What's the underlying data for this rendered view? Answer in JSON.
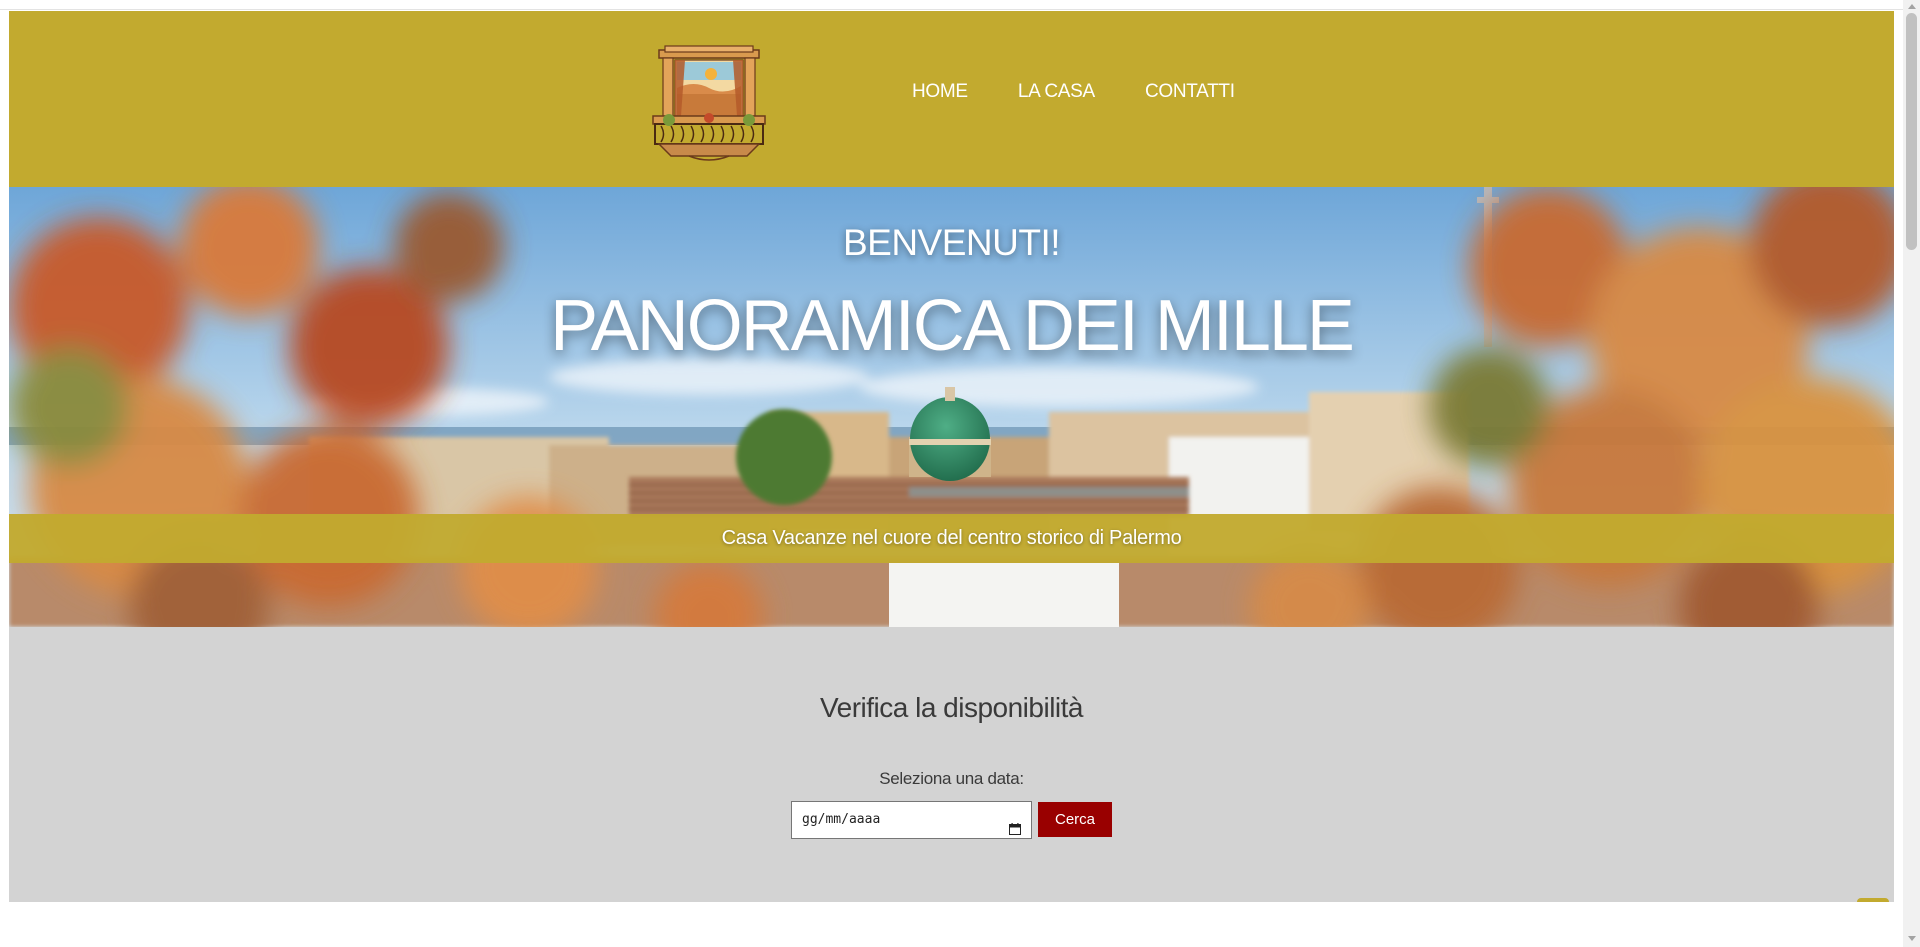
{
  "nav": {
    "items": [
      {
        "label": "HOME"
      },
      {
        "label": "LA CASA"
      },
      {
        "label": "CONTATTI"
      }
    ]
  },
  "hero": {
    "welcome": "BENVENUTI!",
    "title": "PANORAMICA DEI MILLE",
    "tagline": "Casa Vacanze nel cuore del centro storico di Palermo"
  },
  "availability": {
    "title": "Verifica la disponibilità",
    "date_label": "Seleziona una data:",
    "date_placeholder": "gg/mm/aaaa",
    "search_button": "Cerca"
  },
  "icons": {
    "logo": "balcony-logo",
    "calendar": "calendar-icon",
    "scroll_top": "chevron-up-icon"
  },
  "colors": {
    "brand_gold": "#c2aa2f",
    "button_red": "#990000",
    "section_gray": "#d3d3d3"
  }
}
